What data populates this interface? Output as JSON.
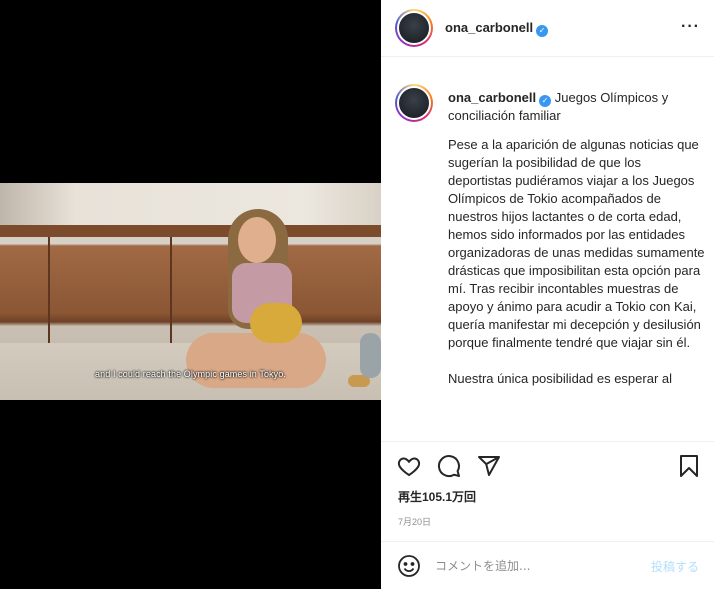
{
  "video": {
    "subtitle": "and I could reach the Olympic games in Tokyo."
  },
  "header": {
    "username": "ona_carbonell",
    "verified_mark": "✓",
    "more_label": "···"
  },
  "post": {
    "username": "ona_carbonell",
    "verified_mark": "✓",
    "title": "Juegos Olímpicos y conciliación familiar",
    "body": "Pese a la aparición de algunas noticias que sugerían la posibilidad de que los deportistas pudiéramos viajar a los Juegos Olímpicos de Tokio acompañados de nuestros hijos lactantes o de corta edad, hemos sido informados por las entidades organizadoras de unas medidas sumamente drásticas que imposibilitan esta opción para mí. Tras recibir incontables muestras de apoyo y ánimo para acudir a Tokio con Kai, quería manifestar mi decepción y desilusión porque finalmente tendré que viajar sin él.\n\nNuestra única posibilidad es esperar al"
  },
  "actions": {
    "icons": [
      "heart-icon",
      "comment-icon",
      "share-icon",
      "bookmark-icon"
    ],
    "views": "再生105.1万回",
    "date": "7月20日"
  },
  "comment_box": {
    "placeholder": "コメントを追加...",
    "post_label": "投稿する"
  },
  "colors": {
    "verified": "#3897f0",
    "post_button_disabled": "#b2dffc",
    "muted_text": "#8e8e8e"
  }
}
